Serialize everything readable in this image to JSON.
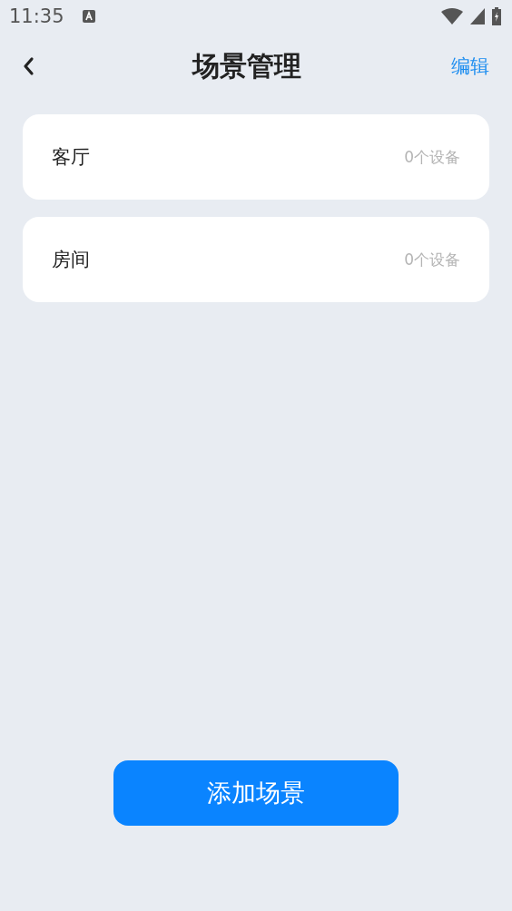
{
  "status_bar": {
    "time": "11:35"
  },
  "header": {
    "title": "场景管理",
    "action": "编辑"
  },
  "scenes": [
    {
      "name": "客厅",
      "count": "0个设备"
    },
    {
      "name": "房间",
      "count": "0个设备"
    }
  ],
  "add_button": "添加场景"
}
